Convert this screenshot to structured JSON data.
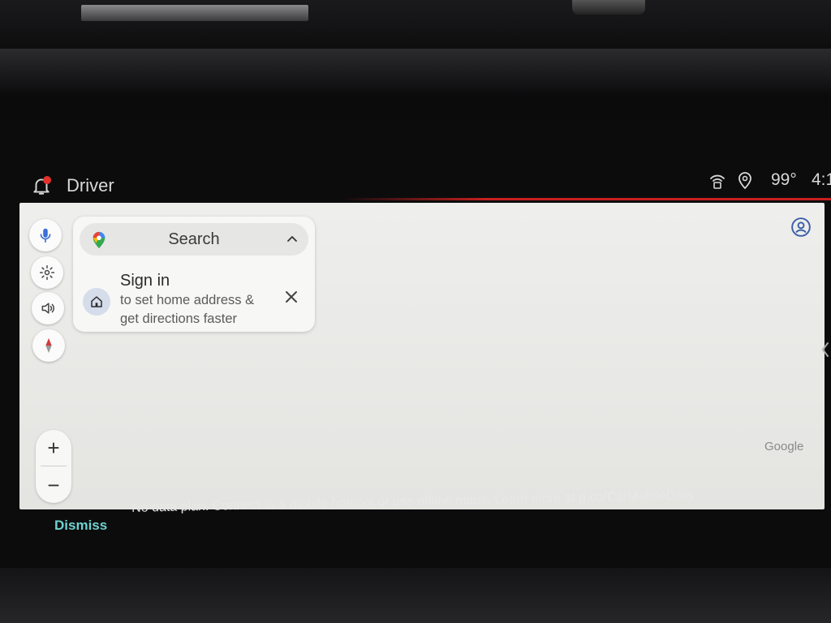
{
  "status_bar": {
    "profile_label": "Driver",
    "temperature": "99°",
    "time": "4:1"
  },
  "map": {
    "search": {
      "label": "Search"
    },
    "signin_card": {
      "title": "Sign in",
      "subtitle": "to set home address & get directions faster"
    },
    "zoom": {
      "in_label": "+",
      "out_label": "−"
    },
    "attribution": "Google"
  },
  "message_bar": {
    "dismiss_label": "Dismiss",
    "text": "No data plan. Connect to a mobile hotspot or use offline maps. Learn more at g.co/CarMobileData"
  },
  "colors": {
    "accent_red": "#c8201e",
    "dismiss_teal": "#6fd1cf",
    "map_background": "#eeeeec"
  },
  "icons": [
    "bell-icon",
    "wifi-hotspot-icon",
    "location-pin-icon",
    "mic-icon",
    "gear-icon",
    "volume-icon",
    "compass-icon",
    "maps-logo-icon",
    "chevron-up-icon",
    "home-icon",
    "close-icon",
    "account-icon",
    "chevron-left-icon"
  ]
}
